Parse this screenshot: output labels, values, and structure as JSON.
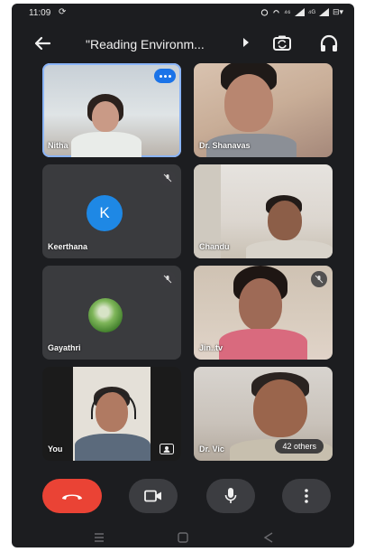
{
  "status_bar": {
    "time": "11:09",
    "left_icons": "⟳",
    "network_text": "⁴⁶",
    "signal_text": "⁴ᴳ",
    "battery_text": "⊟▾"
  },
  "header": {
    "title": "\"Reading Environm...",
    "back_icon": "arrow-left-icon",
    "switch_camera_icon": "switch-camera-icon",
    "audio_icon": "headphones-icon"
  },
  "participants": [
    {
      "name": "Nitha",
      "tile_type": "video",
      "status": "speaking"
    },
    {
      "name": "Dr. Shanavas",
      "tile_type": "video",
      "status": "none"
    },
    {
      "name": "Keerthana",
      "tile_type": "avatar-letter",
      "avatar_letter": "K",
      "avatar_color": "#1e88e5",
      "status": "muted"
    },
    {
      "name": "Chandu",
      "tile_type": "video",
      "status": "none"
    },
    {
      "name": "Gayathri",
      "tile_type": "avatar-photo",
      "status": "muted"
    },
    {
      "name": "Jin..tv",
      "tile_type": "video",
      "status": "muted"
    },
    {
      "name": "You",
      "tile_type": "video",
      "status": "none"
    },
    {
      "name": "Dr. Vic",
      "tile_type": "video",
      "status": "none",
      "others_label": "42 others"
    }
  ],
  "controls": {
    "end_call_icon": "phone-hangup-icon",
    "end_call_color": "#ea4335",
    "camera_icon": "video-camera-icon",
    "mic_icon": "microphone-icon",
    "more_icon": "more-vertical-icon"
  },
  "navigation": {
    "items": [
      "menu-icon",
      "home-icon",
      "back-icon"
    ]
  },
  "colors": {
    "background": "#1c1d20",
    "tile": "#3a3b3e",
    "accent": "#1a73e8"
  }
}
